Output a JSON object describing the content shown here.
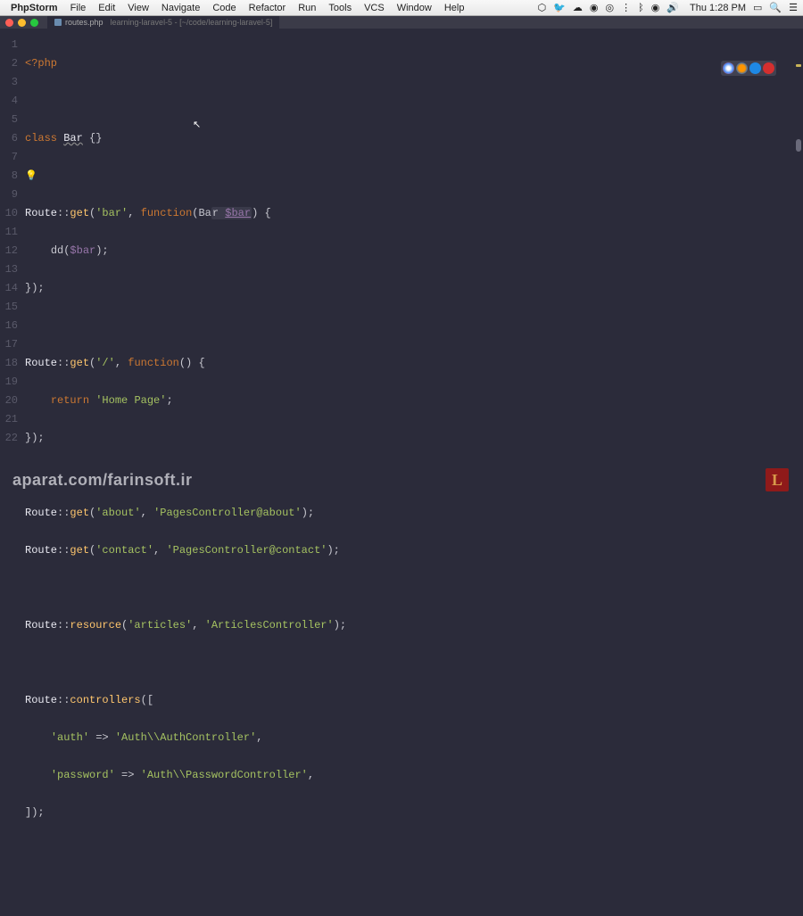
{
  "menubar": {
    "app": "PhpStorm",
    "items": [
      "File",
      "Edit",
      "View",
      "Navigate",
      "Code",
      "Refactor",
      "Run",
      "Tools",
      "VCS",
      "Window",
      "Help"
    ],
    "status": {
      "clock": "Thu 1:28 PM"
    }
  },
  "tab": {
    "filename": "routes.php",
    "subtitle": "learning-laravel-5 - [~/code/learning-laravel-5]"
  },
  "lines": [
    "1",
    "2",
    "3",
    "4",
    "5",
    "6",
    "7",
    "8",
    "9",
    "10",
    "11",
    "12",
    "13",
    "14",
    "15",
    "16",
    "17",
    "18",
    "19",
    "20",
    "21",
    "22"
  ],
  "code": {
    "l1_php": "<?php",
    "l3_class": "class ",
    "l3_bar": "Bar",
    "l3_braces": " {}",
    "l4_bulb": "💡",
    "l5_route": "Route",
    "l5_sep": "::",
    "l5_get": "get",
    "l5_open": "(",
    "l5_str": "'bar'",
    "l5_comma": ", ",
    "l5_fn": "function",
    "l5_p1": "(Ba",
    "l5_p2": "r ",
    "l5_var": "$bar",
    "l5_close": ") {",
    "l6_indent": "    ",
    "l6_dd": "dd",
    "l6_open": "(",
    "l6_var": "$bar",
    "l6_close": ");",
    "l7_close": "});",
    "l9_route": "Route",
    "l9_sep": "::",
    "l9_get": "get",
    "l9_open": "(",
    "l9_str": "'/'",
    "l9_comma": ", ",
    "l9_fn": "function",
    "l9_close": "() {",
    "l10_indent": "    ",
    "l10_return": "return ",
    "l10_str": "'Home Page'",
    "l10_semi": ";",
    "l11_close": "});",
    "l13_route": "Route",
    "l13_sep": "::",
    "l13_get": "get",
    "l13_open": "(",
    "l13_str1": "'about'",
    "l13_comma": ", ",
    "l13_str2": "'PagesController@about'",
    "l13_close": ");",
    "l14_route": "Route",
    "l14_sep": "::",
    "l14_get": "get",
    "l14_open": "(",
    "l14_str1": "'contact'",
    "l14_comma": ", ",
    "l14_str2": "'PagesController@contact'",
    "l14_close": ");",
    "l16_route": "Route",
    "l16_sep": "::",
    "l16_res": "resource",
    "l16_open": "(",
    "l16_str1": "'articles'",
    "l16_comma": ", ",
    "l16_str2": "'ArticlesController'",
    "l16_close": ");",
    "l18_route": "Route",
    "l18_sep": "::",
    "l18_ctrl": "controllers",
    "l18_open": "([",
    "l19_indent": "    ",
    "l19_key": "'auth'",
    "l19_arrow": " => ",
    "l19_val": "'Auth\\\\AuthController'",
    "l19_comma": ",",
    "l20_indent": "    ",
    "l20_key": "'password'",
    "l20_arrow": " => ",
    "l20_val": "'Auth\\\\PasswordController'",
    "l20_comma": ",",
    "l21_close": "]);"
  },
  "watermark": "aparat.com/farinsoft.ir",
  "corner_logo": "L"
}
